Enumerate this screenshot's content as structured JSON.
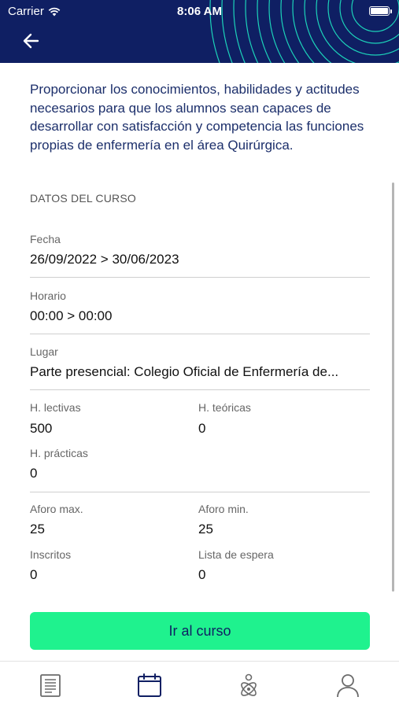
{
  "status_bar": {
    "carrier": "Carrier",
    "time": "8:06 AM"
  },
  "header": {
    "back_icon": "arrow-left-icon",
    "background_color": "#0f1f63",
    "wave_color": "#1ff2c8"
  },
  "description": "Proporcionar los conocimientos, habilidades y actitudes necesarios para que los alumnos sean capaces de desarrollar con satisfacción y competencia las funciones propias de enfermería en el área Quirúrgica.",
  "course_data": {
    "section_title": "DATOS DEL CURSO",
    "fecha_label": "Fecha",
    "fecha_value": "26/09/2022 > 30/06/2023",
    "horario_label": "Horario",
    "horario_value": "00:00 > 00:00",
    "lugar_label": "Lugar",
    "lugar_value": "Parte presencial: Colegio Oficial de Enfermería de...",
    "h_lectivas_label": "H. lectivas",
    "h_lectivas_value": "500",
    "h_teoricas_label": "H. teóricas",
    "h_teoricas_value": "0",
    "h_practicas_label": "H. prácticas",
    "h_practicas_value": "0",
    "aforo_max_label": "Aforo max.",
    "aforo_max_value": "25",
    "aforo_min_label": "Aforo min.",
    "aforo_min_value": "25",
    "inscritos_label": "Inscritos",
    "inscritos_value": "0",
    "lista_espera_label": "Lista de espera",
    "lista_espera_value": "0"
  },
  "cta": {
    "label": "Ir al curso",
    "color": "#1ff28e"
  },
  "tabbar": {
    "tabs": [
      {
        "icon": "document-list-icon",
        "active": false
      },
      {
        "icon": "calendar-icon",
        "active": true
      },
      {
        "icon": "atom-icon",
        "active": false
      },
      {
        "icon": "user-icon",
        "active": false
      }
    ],
    "active_color": "#0f1f63",
    "inactive_color": "#6b6b6b"
  }
}
